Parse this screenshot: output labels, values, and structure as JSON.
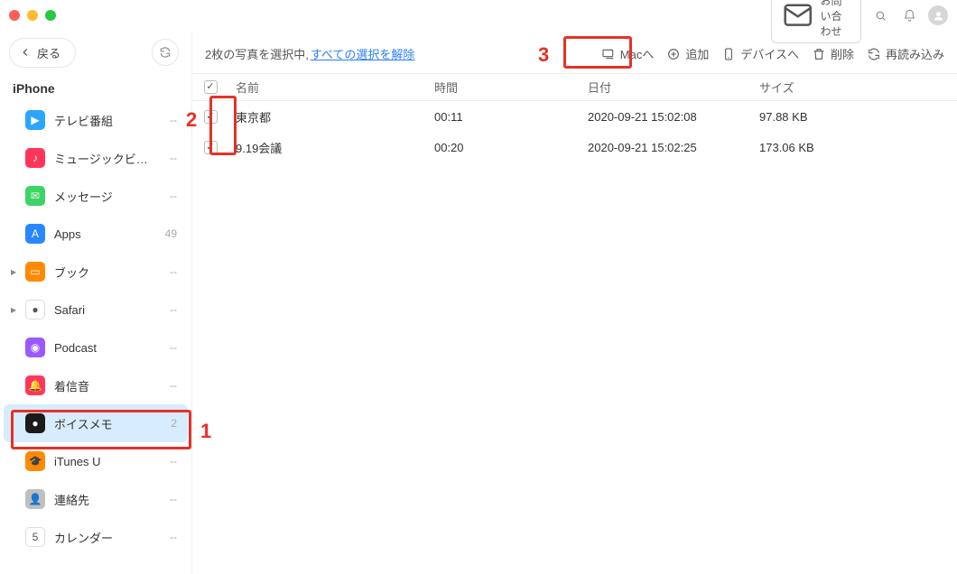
{
  "titlebar": {
    "contact_label": "お問い合わせ"
  },
  "toolbar": {
    "back_label": "戻る"
  },
  "sidebar": {
    "device": "iPhone",
    "items": [
      {
        "label": "テレビ番組",
        "count": "--",
        "iconBg": "#2aa6ff",
        "glyph": "▶"
      },
      {
        "label": "ミュージックビ…",
        "count": "--",
        "iconBg": "#ff3559",
        "glyph": "♪"
      },
      {
        "label": "メッセージ",
        "count": "--",
        "iconBg": "#3cd464",
        "glyph": "✉"
      },
      {
        "label": "Apps",
        "count": "49",
        "iconBg": "#2b87ff",
        "glyph": "A"
      },
      {
        "label": "ブック",
        "count": "--",
        "iconBg": "#ff8a00",
        "glyph": "▭",
        "expandable": true
      },
      {
        "label": "Safari",
        "count": "--",
        "iconBg": "#ffffff",
        "glyph": "●",
        "expandable": true
      },
      {
        "label": "Podcast",
        "count": "--",
        "iconBg": "#9b59ff",
        "glyph": "◉"
      },
      {
        "label": "着信音",
        "count": "--",
        "iconBg": "#ff375f",
        "glyph": "🔔"
      },
      {
        "label": "ボイスメモ",
        "count": "2",
        "iconBg": "#1b1b1b",
        "glyph": "●",
        "selected": true
      },
      {
        "label": "iTunes U",
        "count": "--",
        "iconBg": "#ff8a00",
        "glyph": "🎓"
      },
      {
        "label": "連絡先",
        "count": "--",
        "iconBg": "#bfbfbf",
        "glyph": "👤"
      },
      {
        "label": "カレンダー",
        "count": "--",
        "iconBg": "#ffffff",
        "glyph": "5"
      }
    ]
  },
  "actionbar": {
    "selected_text": "2枚の写真を選択中, ",
    "deselect_all": "すべての選択を解除",
    "to_mac": "Macへ",
    "add": "追加",
    "to_device": "デバイスへ",
    "delete": "削除",
    "reload": "再読み込み"
  },
  "table": {
    "cols": {
      "name": "名前",
      "time": "時間",
      "date": "日付",
      "size": "サイズ"
    },
    "rows": [
      {
        "checked": true,
        "name": "東京都",
        "time": "00:11",
        "date": "2020-09-21 15:02:08",
        "size": "97.88 KB"
      },
      {
        "checked": true,
        "name": "9.19会議",
        "time": "00:20",
        "date": "2020-09-21 15:02:25",
        "size": "173.06 KB"
      }
    ]
  },
  "annotations": {
    "n1": "1",
    "n2": "2",
    "n3": "3"
  }
}
